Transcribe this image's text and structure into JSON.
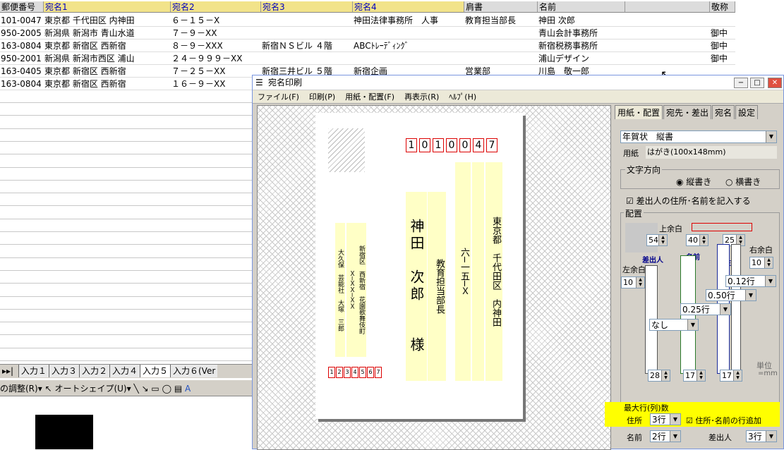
{
  "sheet": {
    "headers": [
      "郵便番号",
      "宛名1",
      "宛名2",
      "宛名3",
      "宛名4",
      "肩書",
      "名前",
      "",
      "敬称"
    ],
    "rows": [
      [
        "101-0047",
        "東京都 千代田区 内神田",
        "６－１５－X",
        "",
        "神田法律事務所　人事",
        "教育担当部長",
        "神田 次郎",
        "",
        ""
      ],
      [
        "950-2005",
        "新潟県 新潟市 青山水道",
        "７－９－XX",
        "",
        "",
        "",
        "青山会計事務所",
        "",
        "御中"
      ],
      [
        "163-0804",
        "東京都 新宿区 西新宿",
        "８－９－XXX",
        "新宿ＮＳビル ４階",
        "ABCﾄﾚｰﾃﾞｨﾝｸﾞ",
        "",
        "新宿税務事務所",
        "",
        "御中"
      ],
      [
        "950-2001",
        "新潟県 新潟市西区 浦山",
        "２４－９９９－XX",
        "",
        "",
        "",
        "浦山デザイン",
        "",
        "御中"
      ],
      [
        "163-0405",
        "東京都 新宿区 西新宿",
        "７－２５－XX",
        "新宿三井ビル ５階",
        "新宿企画",
        "営業部",
        "川島　敬一郎",
        "",
        ""
      ],
      [
        "163-0804",
        "東京都 新宿区 西新宿",
        "１６－９－XX",
        "",
        "",
        "",
        "",
        "",
        ""
      ]
    ],
    "tabs": [
      "入力１",
      "入力３",
      "入力２",
      "入力４",
      "入力５",
      "入力６(Ver"
    ],
    "tab_nav": "▸▸|",
    "drawbar": [
      "の調整(R)▾",
      "オートシェイプ(U)▾"
    ]
  },
  "window": {
    "title": "宛名印刷",
    "menu": [
      "ファイル(F)",
      "印刷(P)",
      "用紙・配置(F)",
      "再表示(R)",
      "ﾍﾙﾌﾟ(H)"
    ]
  },
  "card": {
    "postal": [
      "1",
      "0",
      "1",
      "0",
      "0",
      "4",
      "7"
    ],
    "address1": "東京都　千代田区　内神田",
    "address2": "六─一五─Ｘ",
    "title": "教育担当部長",
    "name": "神田　次郎　　様",
    "sender_address": "新宿区　西新宿　花園歌舞伎町",
    "sender_address2": "Ｘ─ＸＸ─ＸＸ",
    "sender_name": "大久保　芸能社　大塚　三郎",
    "sender_postal": [
      "1",
      "2",
      "3",
      "4",
      "5",
      "6",
      "7"
    ]
  },
  "panel": {
    "tabs": [
      "用紙・配置",
      "宛先・差出",
      "宛名",
      "設定"
    ],
    "paper_type": "年賀状　縦書",
    "paper_label": "用紙",
    "paper_size": "はがき(100x148mm)",
    "text_dir_label": "文字方向",
    "vertical": "縦書き",
    "horizontal": "横書き",
    "include_sender": "差出人の住所･名前を記入する",
    "layout_label": "配置",
    "top_margin": "上余白",
    "top_margin_val": "54",
    "right_margin": "右余白",
    "right_margin_val": "10",
    "left_margin": "左余白",
    "left_margin_val": "10",
    "v40": "40",
    "v25": "25",
    "sender": "差出人",
    "name": "名前",
    "address": "住所",
    "addr_line": "0.12行",
    "name_line": "0.50行",
    "title_line": "0.25行",
    "sender_opt": "なし",
    "b28": "28",
    "b17a": "17",
    "b17b": "17",
    "unit": "単位",
    "unit2": "=mm",
    "max_label": "最大行(列)数",
    "addr_label": "住所",
    "addr_val": "3行",
    "add_line": "住所･名前の行追加",
    "name_label": "名前",
    "name_val": "2行",
    "sender_label": "差出人",
    "sender_val": "3行"
  }
}
